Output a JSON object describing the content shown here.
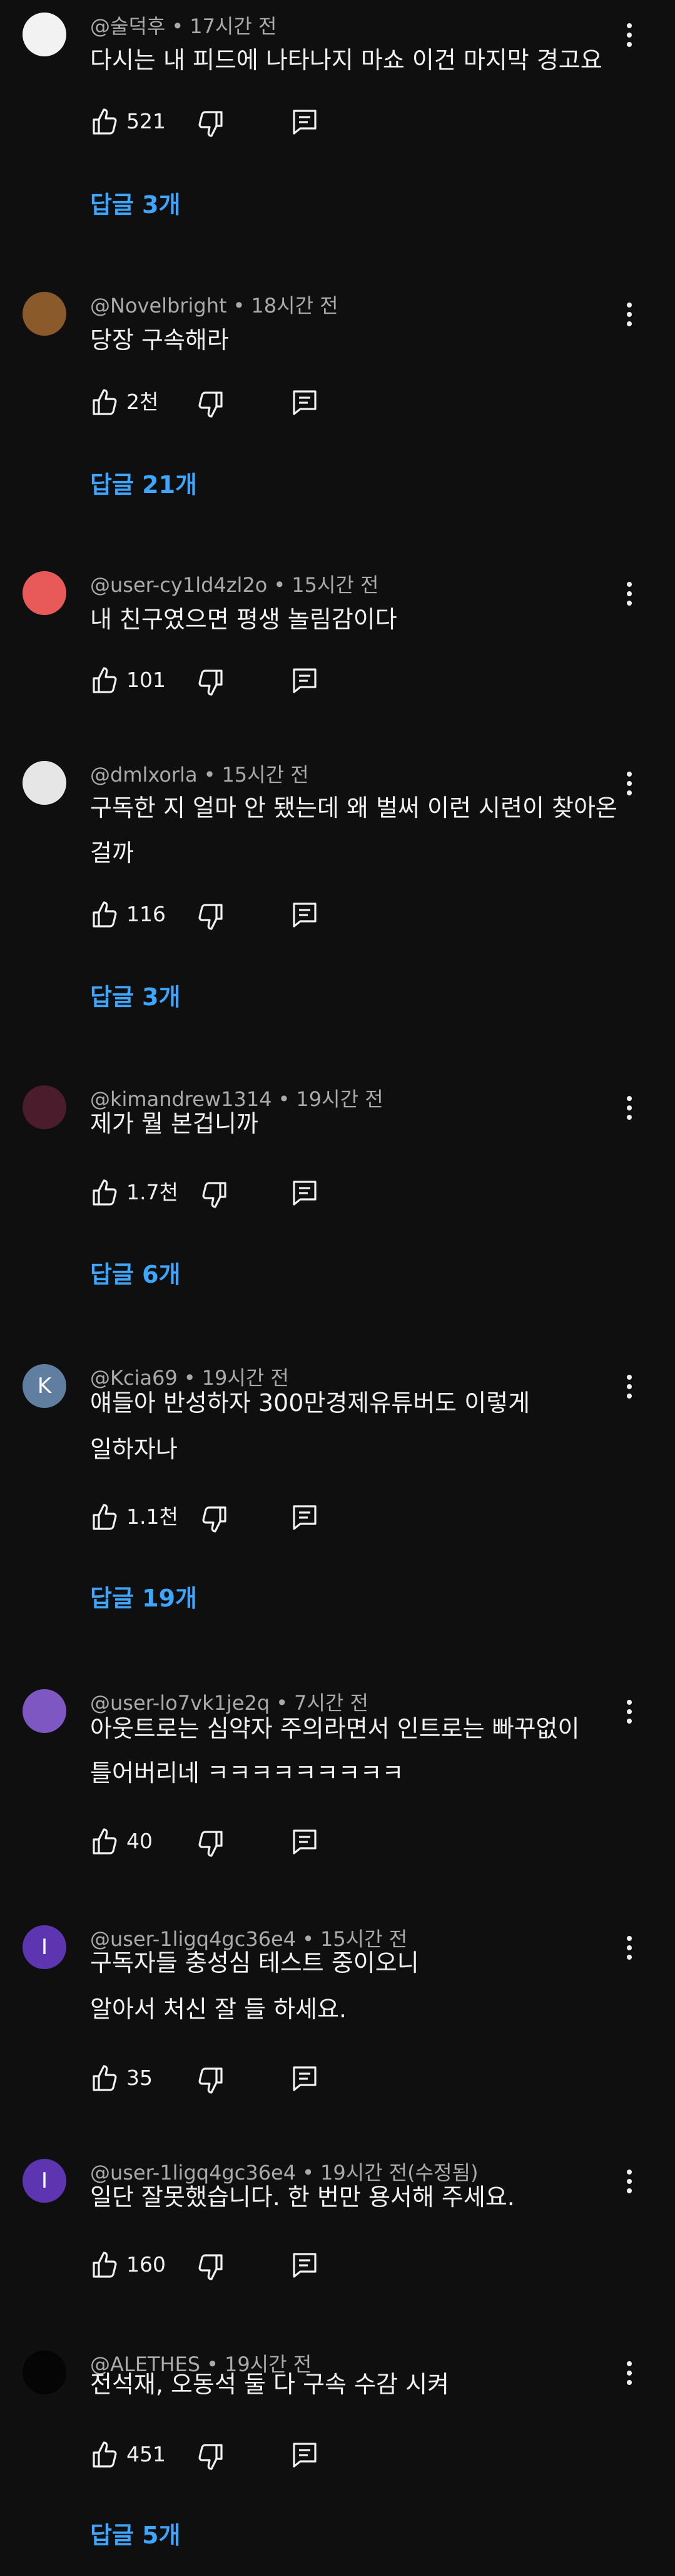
{
  "comments": [
    {
      "handle": "@술덕후",
      "time": "17시간 전",
      "text": [
        "다시는 내 피드에 나타나지 마쇼 이건 마지막 경고요"
      ],
      "likes": "521",
      "replies": "답글 3개",
      "avatar": {
        "color": "#f2f2f2",
        "letter": ""
      }
    },
    {
      "handle": "@Novelbright",
      "time": "18시간 전",
      "text": [
        "당장 구속해라"
      ],
      "likes": "2천",
      "replies": "답글 21개",
      "avatar": {
        "color": "#8a5a2b",
        "letter": ""
      }
    },
    {
      "handle": "@user-cy1ld4zl2o",
      "time": "15시간 전",
      "text": [
        "내 친구였으면 평생 놀림감이다"
      ],
      "likes": "101",
      "replies": "",
      "avatar": {
        "color": "#e85a5a",
        "letter": ""
      }
    },
    {
      "handle": "@dmlxorla",
      "time": "15시간 전",
      "text": [
        "구독한 지 얼마 안 됐는데 왜 벌써 이런 시련이 찾아온",
        "걸까"
      ],
      "likes": "116",
      "replies": "답글 3개",
      "avatar": {
        "color": "#e6e6e6",
        "letter": ""
      }
    },
    {
      "handle": "@kimandrew1314",
      "time": "19시간 전",
      "text": [
        "제가 뭘 본겁니까"
      ],
      "likes": "1.7천",
      "replies": "답글 6개",
      "avatar": {
        "color": "#4a1c2c",
        "letter": ""
      }
    },
    {
      "handle": "@Kcia69",
      "time": "19시간 전",
      "text": [
        "얘들아 반성하자 300만경제유튜버도 이렇게",
        "일하자나"
      ],
      "likes": "1.1천",
      "replies": "답글 19개",
      "avatar": {
        "color": "#5f7ea0",
        "letter": "K"
      }
    },
    {
      "handle": "@user-lo7vk1je2q",
      "time": "7시간 전",
      "text": [
        "아웃트로는 심약자 주의라면서 인트로는 빠꾸없이",
        "틀어버리네 ㅋㅋㅋㅋㅋㅋㅋㅋㅋ"
      ],
      "likes": "40",
      "replies": "",
      "avatar": {
        "color": "#7e57c2",
        "letter": ""
      }
    },
    {
      "handle": "@user-1ligq4gc36e4",
      "time": "15시간 전",
      "text": [
        "구독자들 충성심 테스트 중이오니",
        "알아서 처신 잘 들 하세요."
      ],
      "likes": "35",
      "replies": "",
      "avatar": {
        "color": "#5e35b1",
        "letter": "I"
      }
    },
    {
      "handle": "@user-1ligq4gc36e4",
      "time": "19시간 전(수정됨)",
      "text": [
        "일단 잘못했습니다. 한 번만 용서해 주세요."
      ],
      "likes": "160",
      "replies": "",
      "avatar": {
        "color": "#5e35b1",
        "letter": "I"
      }
    },
    {
      "handle": "@ALETHES",
      "time": "19시간 전",
      "text": [
        "전석재, 오동석 둘 다 구속 수감 시켜"
      ],
      "likes": "451",
      "replies": "답글 5개",
      "avatar": {
        "color": "#050505",
        "letter": ""
      }
    }
  ]
}
